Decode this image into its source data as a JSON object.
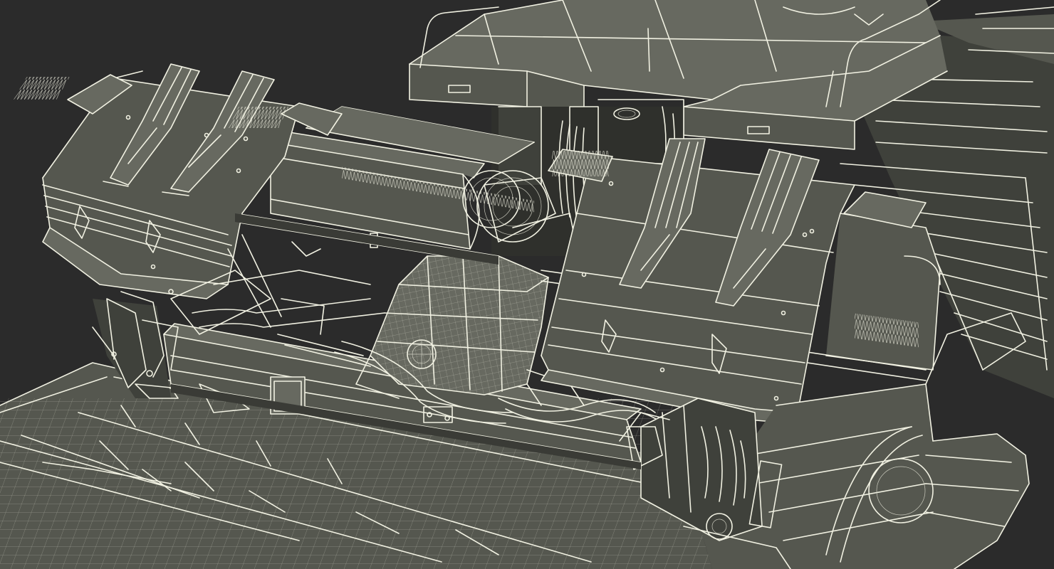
{
  "scene": {
    "subject": "wireframe-3d-render",
    "palette": {
      "background": "#2b2b2b",
      "surface": "#55574f",
      "surface_light": "#676960",
      "surface_dark": "#3f413b",
      "wire": "#f1f1e2"
    }
  }
}
